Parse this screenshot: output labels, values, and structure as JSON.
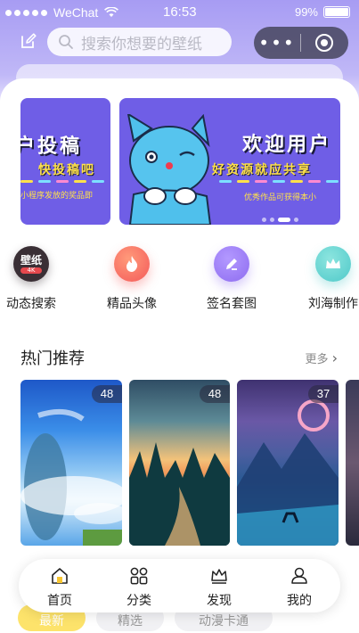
{
  "status_bar": {
    "carrier": "WeChat",
    "time": "16:53",
    "battery": "99%"
  },
  "search": {
    "placeholder": "搜索你想要的壁纸"
  },
  "banner": {
    "slide_left": {
      "title": "户投稿",
      "subtitle": "快投稿吧",
      "small": "小程序发放的奖品即"
    },
    "slide_main": {
      "title": "欢迎用户",
      "subtitle": "好资源就应共享",
      "small": "优秀作品可获得本小"
    }
  },
  "quick_entries": [
    {
      "label": "动态搜索",
      "icon": "wallpaper-4k-icon",
      "badge": "壁纸",
      "badge_sub": "4K",
      "color": "#3a2f35"
    },
    {
      "label": "精品头像",
      "icon": "flame-icon",
      "color": "#f45a5a"
    },
    {
      "label": "签名套图",
      "icon": "pen-icon",
      "color": "#8e6cf0"
    },
    {
      "label": "刘海制作",
      "icon": "crown-icon",
      "color": "#4fc9c9"
    }
  ],
  "section": {
    "title": "热门推荐",
    "more": "更多"
  },
  "wallpapers": [
    {
      "count": "48"
    },
    {
      "count": "48"
    },
    {
      "count": "37"
    }
  ],
  "tabs": [
    {
      "label": "首页",
      "icon": "home-icon",
      "active": true
    },
    {
      "label": "分类",
      "icon": "category-grid-icon"
    },
    {
      "label": "发现",
      "icon": "crown-icon"
    },
    {
      "label": "我的",
      "icon": "user-icon"
    }
  ],
  "chips": [
    {
      "label": "最新",
      "active": true
    },
    {
      "label": "精选"
    },
    {
      "label": "动漫卡通"
    }
  ]
}
